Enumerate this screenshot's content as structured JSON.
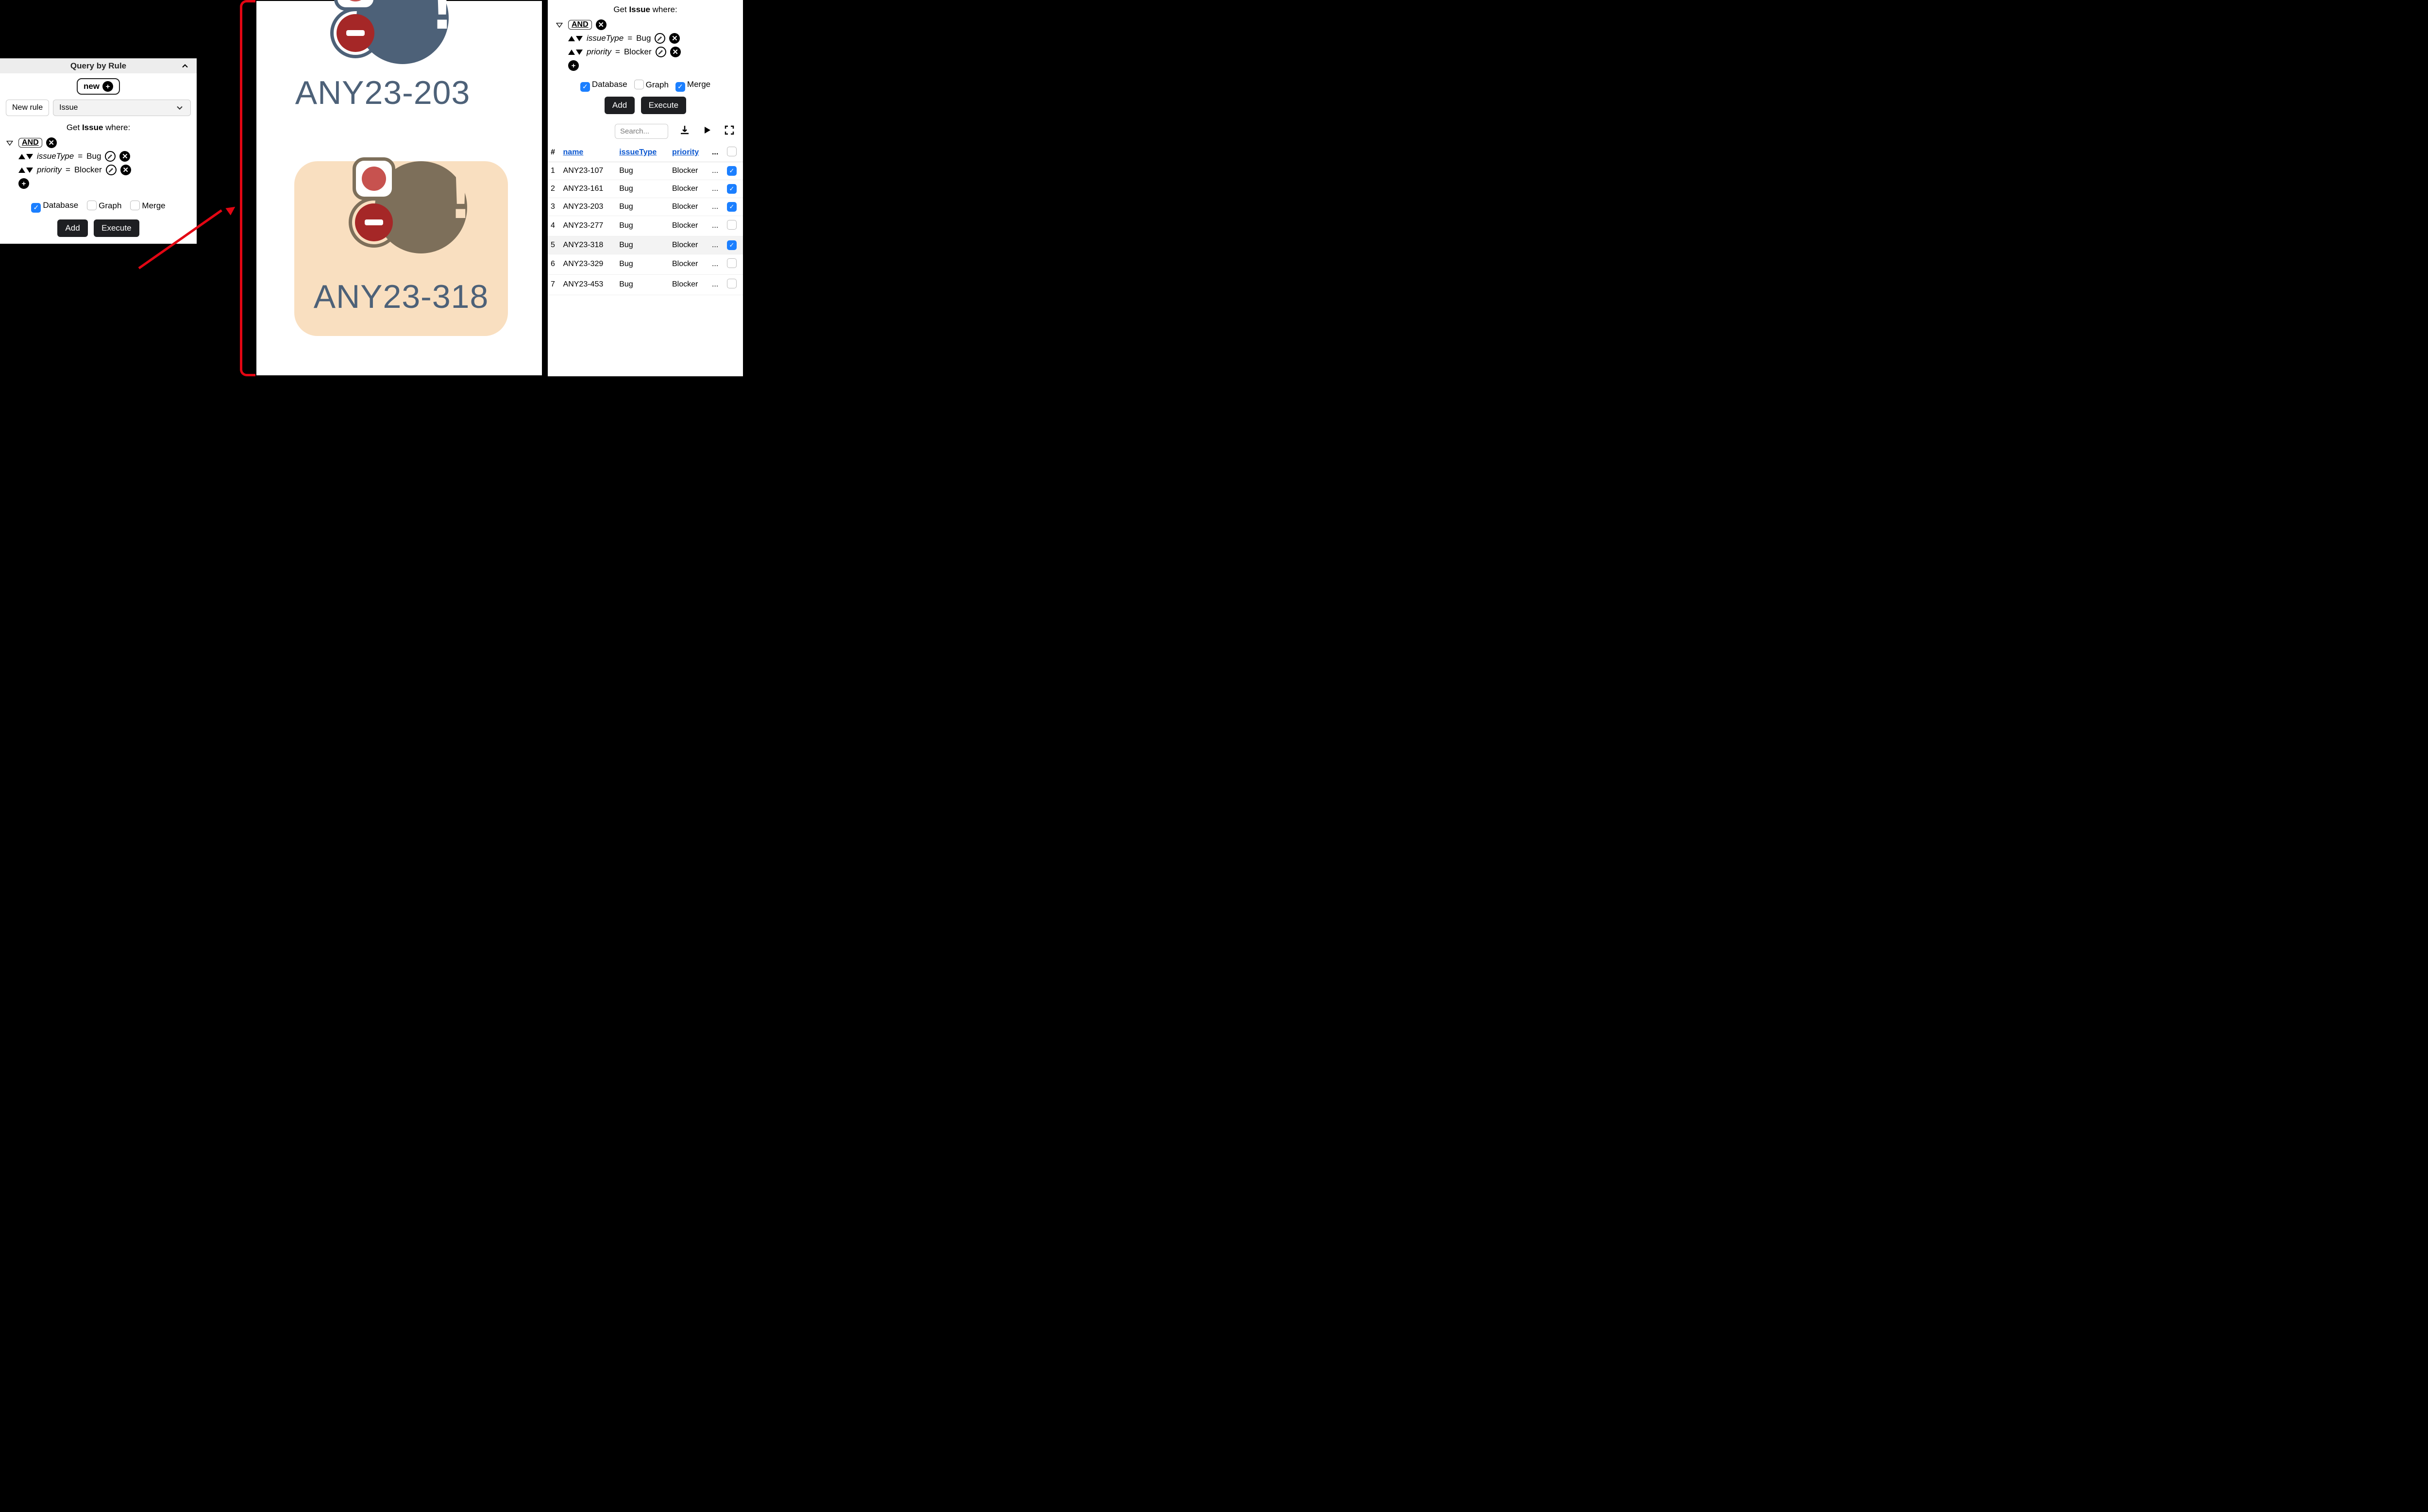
{
  "panel": {
    "title": "Query by Rule",
    "new_label": "new",
    "new_rule_label": "New rule",
    "entity": "Issue",
    "get_prefix": "Get ",
    "get_entity": "Issue",
    "get_suffix": " where:",
    "and": "AND",
    "rules": [
      {
        "field": "issueType",
        "op": "=",
        "value": "Bug"
      },
      {
        "field": "priority",
        "op": "=",
        "value": "Blocker"
      }
    ],
    "opts": {
      "database": {
        "label": "Database",
        "checked": true
      },
      "graph": {
        "label": "Graph",
        "checked": false
      },
      "merge": {
        "label": "Merge",
        "checked": false
      }
    },
    "add": "Add",
    "execute": "Execute"
  },
  "right_opts": {
    "database": {
      "label": "Database",
      "checked": true
    },
    "graph": {
      "label": "Graph",
      "checked": false
    },
    "merge": {
      "label": "Merge",
      "checked": true
    }
  },
  "cards": [
    {
      "label": "ANY23-203",
      "selected": false
    },
    {
      "label": "ANY23-318",
      "selected": true
    }
  ],
  "table": {
    "search_placeholder": "Search...",
    "columns": {
      "num": "#",
      "name": "name",
      "issueType": "issueType",
      "priority": "priority",
      "more": "..."
    },
    "rows": [
      {
        "n": "1",
        "name": "ANY23-107",
        "issueType": "Bug",
        "priority": "Blocker",
        "more": "...",
        "checked": true,
        "highlight": false
      },
      {
        "n": "2",
        "name": "ANY23-161",
        "issueType": "Bug",
        "priority": "Blocker",
        "more": "...",
        "checked": true,
        "highlight": false
      },
      {
        "n": "3",
        "name": "ANY23-203",
        "issueType": "Bug",
        "priority": "Blocker",
        "more": "...",
        "checked": true,
        "highlight": false
      },
      {
        "n": "4",
        "name": "ANY23-277",
        "issueType": "Bug",
        "priority": "Blocker",
        "more": "...",
        "checked": false,
        "highlight": false
      },
      {
        "n": "5",
        "name": "ANY23-318",
        "issueType": "Bug",
        "priority": "Blocker",
        "more": "...",
        "checked": true,
        "highlight": true
      },
      {
        "n": "6",
        "name": "ANY23-329",
        "issueType": "Bug",
        "priority": "Blocker",
        "more": "...",
        "checked": false,
        "highlight": false
      },
      {
        "n": "7",
        "name": "ANY23-453",
        "issueType": "Bug",
        "priority": "Blocker",
        "more": "...",
        "checked": false,
        "highlight": false
      }
    ]
  }
}
